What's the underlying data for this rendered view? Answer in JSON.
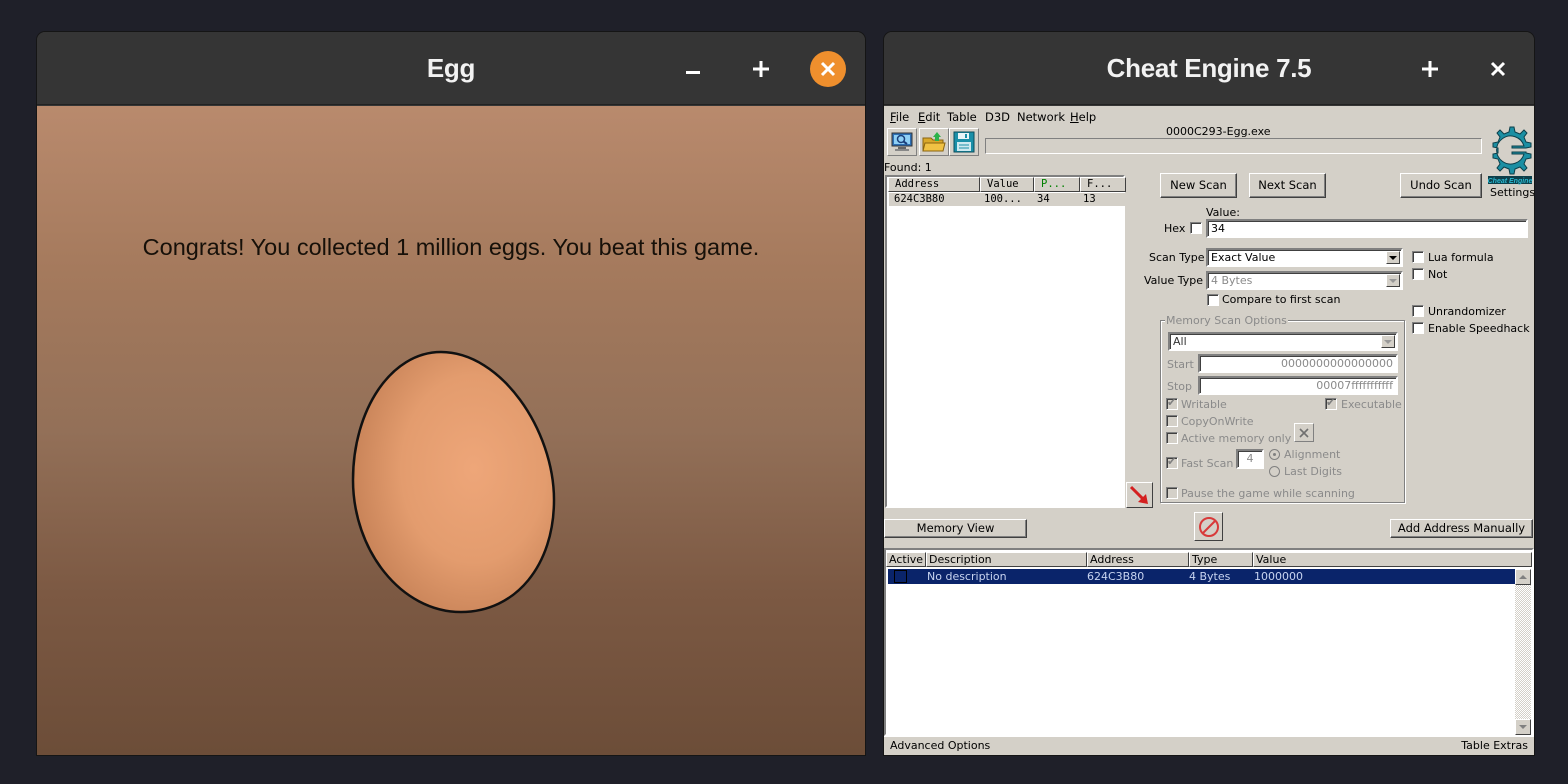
{
  "egg_window": {
    "title": "Egg",
    "controls": {
      "minimize": "–",
      "maximize": "+",
      "close": "×"
    },
    "message": "Congrats! You collected 1 million eggs. You beat this game.",
    "colors": {
      "close_button": "#ef8f2d",
      "egg": "#e9a072"
    }
  },
  "ce_window": {
    "title": "Cheat Engine 7.5",
    "controls": {
      "maximize": "+",
      "close": "×"
    },
    "menu": [
      {
        "label": "File",
        "underline": "F",
        "rest": "ile"
      },
      {
        "label": "Edit",
        "underline": "E",
        "rest": "dit"
      },
      {
        "label": "Table",
        "underline": "",
        "rest": "Table"
      },
      {
        "label": "D3D",
        "underline": "",
        "rest": "D3D"
      },
      {
        "label": "Network",
        "underline": "",
        "rest": "Network"
      },
      {
        "label": "Help",
        "underline": "H",
        "rest": "elp"
      }
    ],
    "toolbar": {
      "open_process_icon": "computer-search-icon",
      "open_file_icon": "folder-open-icon",
      "save_icon": "floppy-disk-icon"
    },
    "process_name": "0000C293-Egg.exe",
    "found_label": "Found: 1",
    "scan_results": {
      "columns": [
        "Address",
        "Value",
        "P...",
        "F..."
      ],
      "rows": [
        {
          "address": "624C3B80",
          "value": "100...",
          "previous": "34",
          "first": "13"
        }
      ]
    },
    "buttons": {
      "new_scan": "New Scan",
      "next_scan": "Next Scan",
      "undo_scan": "Undo Scan",
      "settings": "Settings",
      "memory_view": "Memory View",
      "add_address_manually": "Add Address Manually"
    },
    "logo_text": "Cheat Engine",
    "value_label": "Value:",
    "hex_label": "Hex",
    "hex_checked": false,
    "value_input": "34",
    "scan_type_label": "Scan Type",
    "scan_type_value": "Exact Value",
    "value_type_label": "Value Type",
    "value_type_value": "4 Bytes",
    "compare_first_label": "Compare to first scan",
    "lua_formula_label": "Lua formula",
    "not_label": "Not",
    "unrandomizer_label": "Unrandomizer",
    "speedhack_label": "Enable Speedhack",
    "memory_scan_options": {
      "title": "Memory Scan Options",
      "region": "All",
      "start_label": "Start",
      "start_value": "0000000000000000",
      "stop_label": "Stop",
      "stop_value": "00007fffffffffff",
      "writable_label": "Writable",
      "writable_checked": true,
      "executable_label": "Executable",
      "executable_checked": true,
      "copy_on_write_label": "CopyOnWrite",
      "active_memory_label": "Active memory only",
      "fast_scan_label": "Fast Scan",
      "fast_scan_checked": true,
      "fast_scan_value": "4",
      "alignment_label": "Alignment",
      "last_digits_label": "Last Digits",
      "pause_label": "Pause the game while scanning"
    },
    "address_table": {
      "columns": [
        "Active",
        "Description",
        "Address",
        "Type",
        "Value"
      ],
      "rows": [
        {
          "active": false,
          "description": "No description",
          "address": "624C3B80",
          "type": "4 Bytes",
          "value": "1000000"
        }
      ]
    },
    "status": {
      "advanced_options": "Advanced Options",
      "table_extras": "Table Extras"
    },
    "colors": {
      "selection": "#0a246a",
      "panel": "#d4d0c8",
      "logo": "#1b8fa3",
      "previous_header": "#008000"
    }
  }
}
